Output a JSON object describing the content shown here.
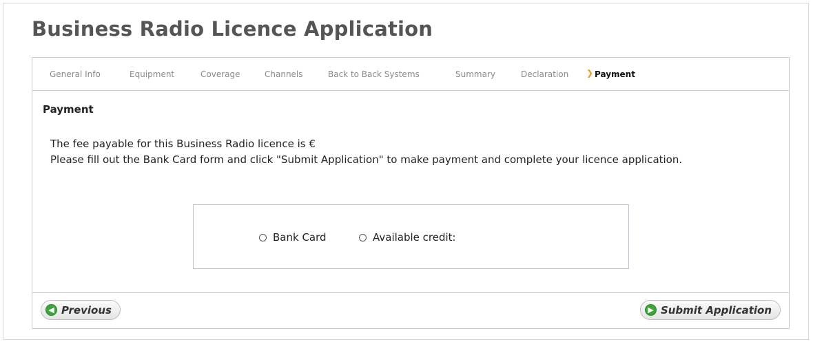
{
  "page": {
    "title": "Business Radio Licence Application"
  },
  "steps": [
    {
      "label": "General Info",
      "active": false
    },
    {
      "label": "Equipment",
      "active": false
    },
    {
      "label": "Coverage",
      "active": false
    },
    {
      "label": "Channels",
      "active": false
    },
    {
      "label": "Back to Back Systems",
      "active": false
    },
    {
      "label": "Summary",
      "active": false
    },
    {
      "label": "Declaration",
      "active": false
    },
    {
      "label": "Payment",
      "active": true
    }
  ],
  "section": {
    "title": "Payment",
    "fee_line": "The fee payable for this Business Radio licence is €",
    "instruction_line": "Please fill out the Bank Card form and click \"Submit Application\" to make payment and complete your licence application."
  },
  "payment_options": [
    {
      "label": "Bank Card",
      "selected": false
    },
    {
      "label": "Available credit:",
      "selected": false
    }
  ],
  "buttons": {
    "previous": "Previous",
    "submit": "Submit Application"
  },
  "colors": {
    "active_step_marker": "#f39a1e",
    "button_icon": "#3ea33b"
  }
}
